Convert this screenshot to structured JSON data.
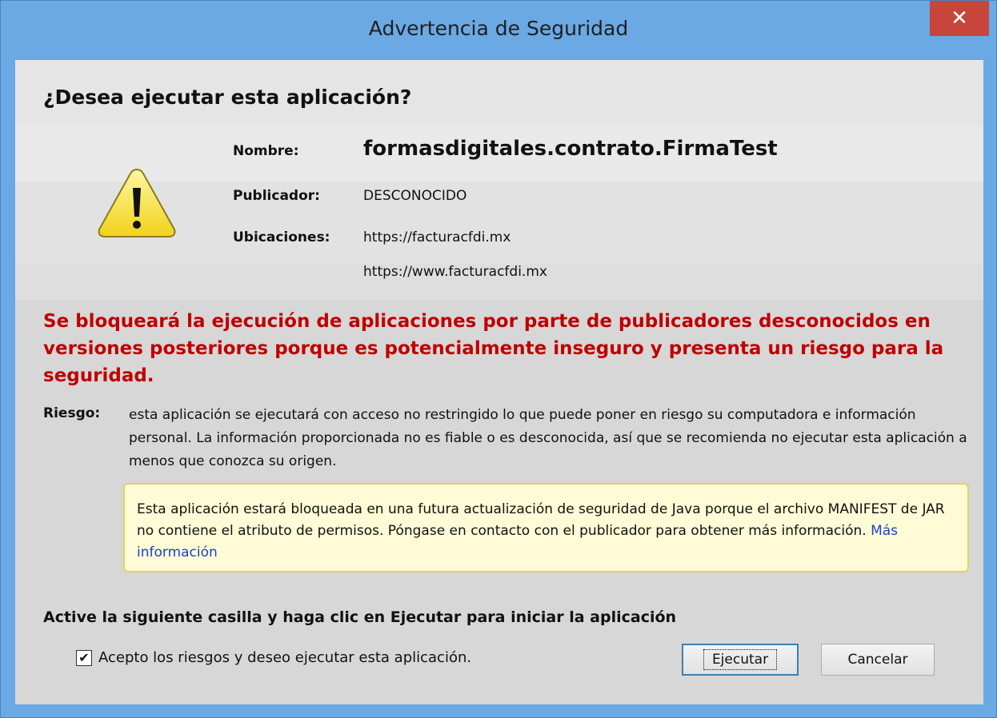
{
  "window": {
    "title": "Advertencia de Seguridad",
    "close_glyph": "✕"
  },
  "dialog": {
    "heading": "¿Desea ejecutar esta aplicación?",
    "name_label": "Nombre:",
    "name_value": "formasdigitales.contrato.FirmaTest",
    "publisher_label": "Publicador:",
    "publisher_value": "DESCONOCIDO",
    "locations_label": "Ubicaciones:",
    "locations": [
      "https://facturacfdi.mx",
      "https://www.facturacfdi.mx"
    ],
    "warning_message": "Se bloqueará la ejecución de aplicaciones por parte de publicadores desconocidos en versiones posteriores porque es potencialmente inseguro y presenta un riesgo para la seguridad.",
    "risk_label": "Riesgo:",
    "risk_text": "esta aplicación se ejecutará con acceso no restringido lo que puede poner en riesgo su computadora e información personal. La información proporcionada no es fiable o es desconocida, así que se recomienda no ejecutar esta aplicación a menos que conozca su origen.",
    "notice_text": "Esta aplicación estará bloqueada en una futura actualización de seguridad de Java porque el archivo MANIFEST de JAR no contiene el atributo de permisos. Póngase en contacto con el publicador para obtener más información.",
    "notice_link": "Más información",
    "activate_text": "Active la siguiente casilla y haga clic en Ejecutar para iniciar la aplicación",
    "accept_checkbox_label": "Acepto los riesgos y deseo ejecutar esta aplicación.",
    "accept_checked": true,
    "check_glyph": "✔",
    "run_button": "Ejecutar",
    "cancel_button": "Cancelar"
  },
  "colors": {
    "title_bar": "#6aa9e3",
    "close_button": "#c7453a",
    "warning_red": "#c00000",
    "notice_bg": "#fffbd6",
    "link": "#1a3fd0"
  }
}
